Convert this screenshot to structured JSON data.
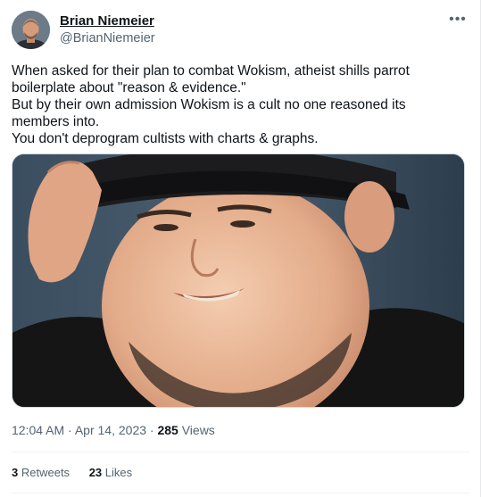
{
  "author": {
    "display_name": "Brian Niemeier",
    "handle": "@BrianNiemeier"
  },
  "more_icon": "more-horizontal-icon",
  "tweet_lines": [
    "When asked for their plan to combat Wokism, atheist shills parrot",
    "boilerplate about \"reason & evidence.\"",
    "But by their own admission Wokism is a cult no one reasoned its",
    "members into.",
    "You don't deprogram cultists with charts & graphs."
  ],
  "meta": {
    "time": "12:04 AM",
    "separator": "·",
    "date": "Apr 14, 2023",
    "views_count": "285",
    "views_label": "Views"
  },
  "stats": {
    "retweets_count": "3",
    "retweets_label": "Retweets",
    "likes_count": "23",
    "likes_label": "Likes"
  },
  "colors": {
    "text": "#0f1419",
    "secondary": "#536471",
    "border": "#cfd9de"
  }
}
